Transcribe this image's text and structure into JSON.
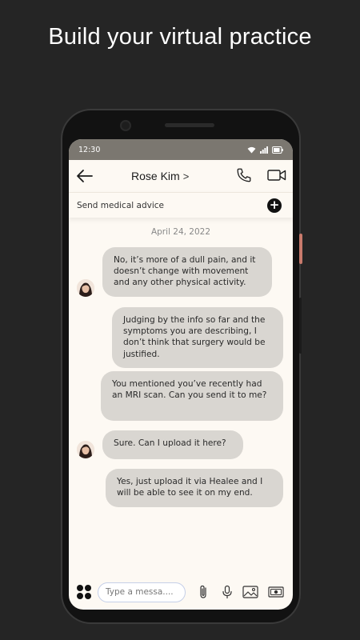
{
  "headline": "Build your virtual practice",
  "status": {
    "time": "12:30"
  },
  "header": {
    "contact_name": "Rose Kim",
    "chevron": ">"
  },
  "advice_bar": {
    "label": "Send medical advice"
  },
  "chat": {
    "date": "April 24, 2022",
    "messages": [
      {
        "side": "left",
        "text": "No, it’s more of a dull pain, and it doesn’t change with movement and any other physical activity."
      },
      {
        "side": "right",
        "text": "Judging by the info so far and the symptoms you are describing, I don’t think that surgery would be justified."
      },
      {
        "side": "right",
        "text": "You mentioned you’ve recently had an MRI scan. Can you send it to me?"
      },
      {
        "side": "left",
        "text": "Sure. Can I upload it here?"
      },
      {
        "side": "right",
        "text": "Yes, just upload it via Healee and I will be able to see it on my end."
      }
    ]
  },
  "composer": {
    "placeholder": "Type a messa...."
  },
  "colors": {
    "screen_bg": "#fdf9f3",
    "bubble": "#d9d6d1",
    "status_bar": "#7b7770",
    "page_bg": "#252525"
  }
}
